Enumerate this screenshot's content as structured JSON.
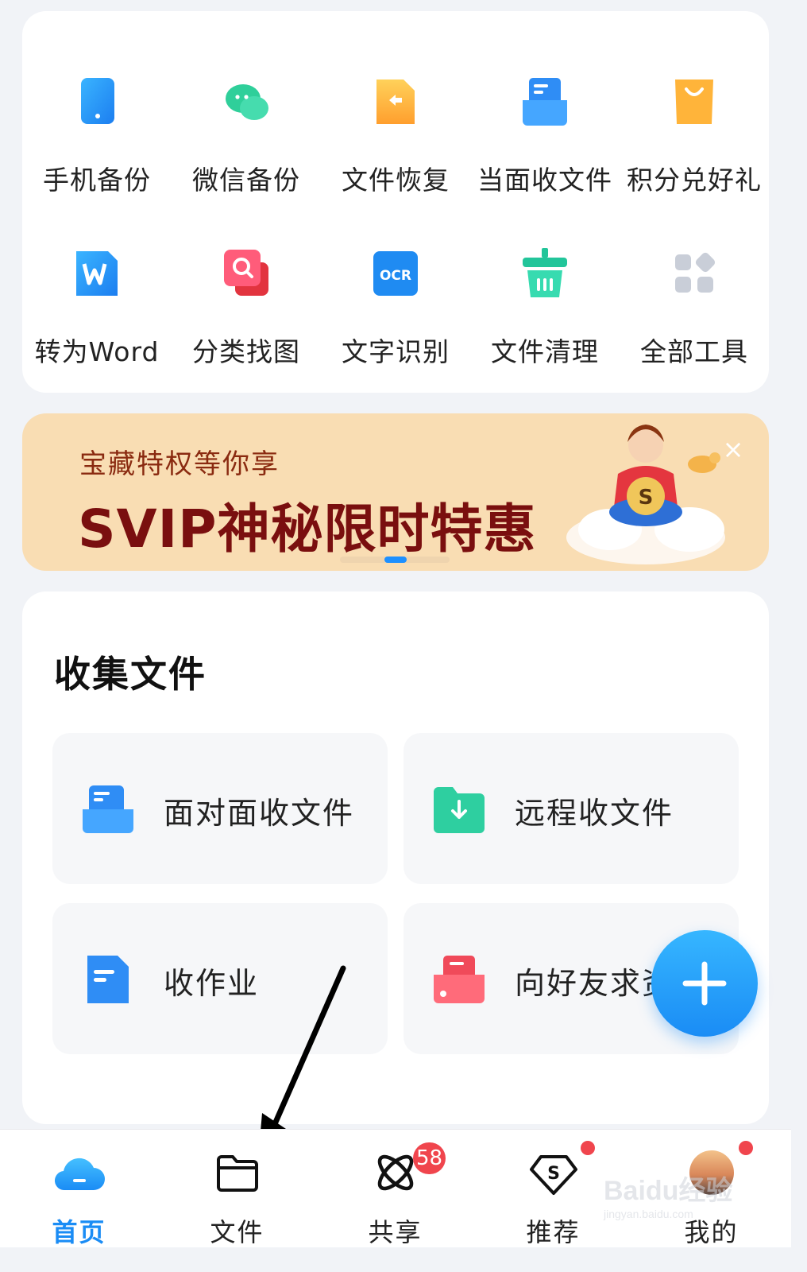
{
  "tools": [
    {
      "label": "手机备份",
      "icon": "phone-backup-icon"
    },
    {
      "label": "微信备份",
      "icon": "wechat-icon"
    },
    {
      "label": "文件恢复",
      "icon": "file-restore-icon"
    },
    {
      "label": "当面收文件",
      "icon": "receive-file-icon"
    },
    {
      "label": "积分兑好礼",
      "icon": "gift-bag-icon"
    },
    {
      "label": "转为Word",
      "icon": "word-icon"
    },
    {
      "label": "分类找图",
      "icon": "image-search-icon"
    },
    {
      "label": "文字识别",
      "icon": "ocr-icon"
    },
    {
      "label": "文件清理",
      "icon": "trash-icon"
    },
    {
      "label": "全部工具",
      "icon": "all-tools-icon"
    }
  ],
  "ocr_badge": "OCR",
  "banner": {
    "subtitle": "宝藏特权等你享",
    "title": "SVIP神秘限时特惠",
    "close": "×"
  },
  "collect": {
    "title": "收集文件",
    "items": [
      {
        "label": "面对面收文件",
        "icon": "face-to-face-receive-icon"
      },
      {
        "label": "远程收文件",
        "icon": "remote-receive-icon"
      },
      {
        "label": "收作业",
        "icon": "homework-icon"
      },
      {
        "label": "向好友求资",
        "icon": "request-from-friend-icon"
      }
    ]
  },
  "tabbar": {
    "tabs": [
      {
        "label": "首页",
        "icon": "home-cloud-icon",
        "active": true
      },
      {
        "label": "文件",
        "icon": "folder-icon"
      },
      {
        "label": "共享",
        "icon": "share-icon",
        "badge": "58"
      },
      {
        "label": "推荐",
        "icon": "recommend-icon"
      },
      {
        "label": "我的",
        "icon": "avatar"
      }
    ]
  },
  "watermark": {
    "text": "Baidu经验",
    "sub": "jingyan.baidu.com"
  },
  "colors": {
    "accent": "#1a8cf5",
    "banner_bg": "#f9ddb3",
    "badge": "#f0454d"
  }
}
